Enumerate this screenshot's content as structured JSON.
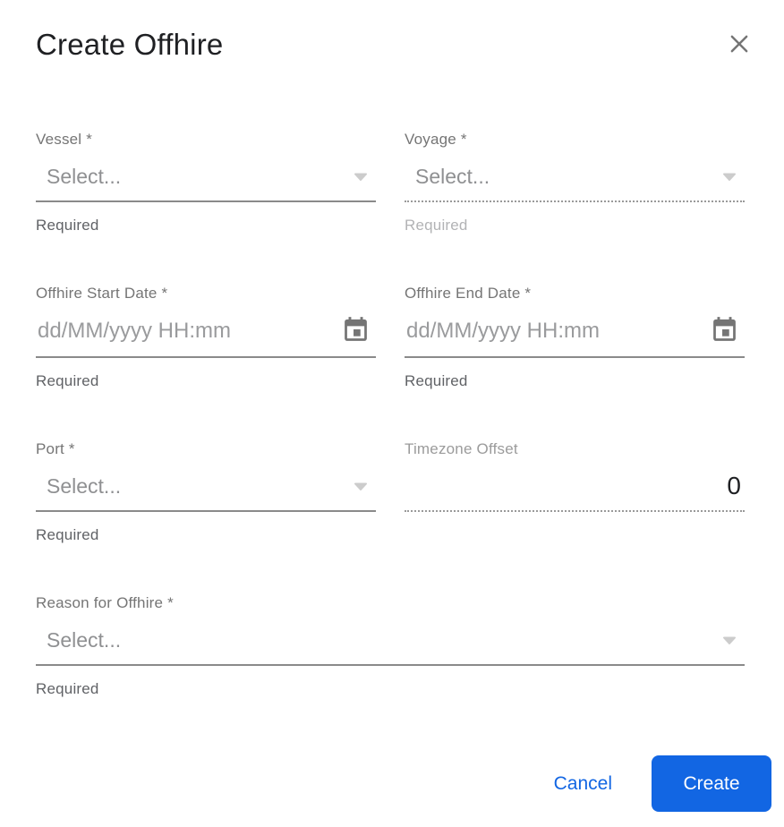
{
  "dialog": {
    "title": "Create Offhire"
  },
  "fields": {
    "vessel": {
      "label": "Vessel *",
      "placeholder": "Select...",
      "helper": "Required"
    },
    "voyage": {
      "label": "Voyage *",
      "placeholder": "Select...",
      "helper": "Required",
      "state": "disabled"
    },
    "offhire_start_date": {
      "label": "Offhire Start Date *",
      "placeholder": "dd/MM/yyyy HH:mm",
      "helper": "Required"
    },
    "offhire_end_date": {
      "label": "Offhire End Date *",
      "placeholder": "dd/MM/yyyy HH:mm",
      "helper": "Required"
    },
    "port": {
      "label": "Port *",
      "placeholder": "Select...",
      "helper": "Required"
    },
    "timezone_offset": {
      "label": "Timezone Offset",
      "value": "0",
      "state": "disabled"
    },
    "reason_for_offhire": {
      "label": "Reason for Offhire *",
      "placeholder": "Select...",
      "helper": "Required"
    }
  },
  "footer": {
    "cancel_label": "Cancel",
    "create_label": "Create"
  },
  "colors": {
    "accent_blue": "#1266e3",
    "title_dark": "#1f2023",
    "label_gray": "#757575",
    "placeholder_gray": "#8f9092",
    "helper_gray": "#606266",
    "helper_disabled_gray": "#b2b3b5",
    "underline_gray": "#8a8a8a",
    "icon_gray": "#757575"
  }
}
